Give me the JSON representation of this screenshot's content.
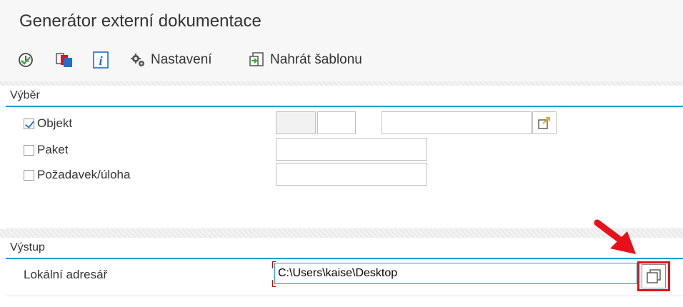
{
  "title": "Generátor externí dokumentace",
  "toolbar": {
    "settings_label": "Nastavení",
    "upload_template_label": "Nahrát šablonu"
  },
  "selection": {
    "header": "Výběr",
    "object_label": "Objekt",
    "object_checked": true,
    "package_label": "Paket",
    "package_checked": false,
    "request_label": "Požadavek/úloha",
    "request_checked": false
  },
  "output": {
    "header": "Výstup",
    "local_dir_label": "Lokální adresář",
    "local_dir_value": "C:\\Users\\kaise\\Desktop"
  },
  "colors": {
    "accent": "#1a9ad6",
    "highlight": "#e8101b"
  }
}
